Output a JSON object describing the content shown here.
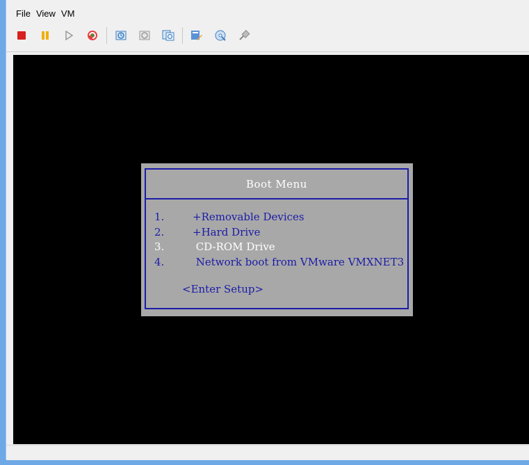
{
  "menu": {
    "file": "File",
    "view": "View",
    "vm": "VM"
  },
  "toolbar": {
    "buttons": [
      {
        "name": "power-off-icon",
        "color": "#d82020"
      },
      {
        "name": "pause-icon",
        "color": "#f0b000"
      },
      {
        "name": "play-icon",
        "color": "#9a9a9a"
      },
      {
        "name": "reset-icon",
        "color": "#e03030"
      },
      {
        "name": "snapshot-icon",
        "color": "#3f7fc0"
      },
      {
        "name": "revert-snapshot-icon",
        "color": "#9a9a9a"
      },
      {
        "name": "snapshot-manager-icon",
        "color": "#3f7fc0"
      },
      {
        "name": "edit-settings-icon",
        "color": "#3f7fc0"
      },
      {
        "name": "connect-cd-icon",
        "color": "#3f7fc0"
      },
      {
        "name": "connect-device-icon",
        "color": "#9a9a9a"
      }
    ]
  },
  "boot_menu": {
    "title": "Boot Menu",
    "entries": [
      {
        "num": "1.",
        "label": "+Removable Devices",
        "selected": false
      },
      {
        "num": "2.",
        "label": "+Hard Drive",
        "selected": false
      },
      {
        "num": "3.",
        "label": " CD-ROM Drive",
        "selected": true
      },
      {
        "num": "4.",
        "label": " Network boot from VMware VMXNET3",
        "selected": false
      }
    ],
    "setup": "<Enter Setup>"
  },
  "colors": {
    "boot_bg": "#a8a8a8",
    "boot_blue": "#1b1ba8",
    "selected_text": "#ffffff"
  }
}
